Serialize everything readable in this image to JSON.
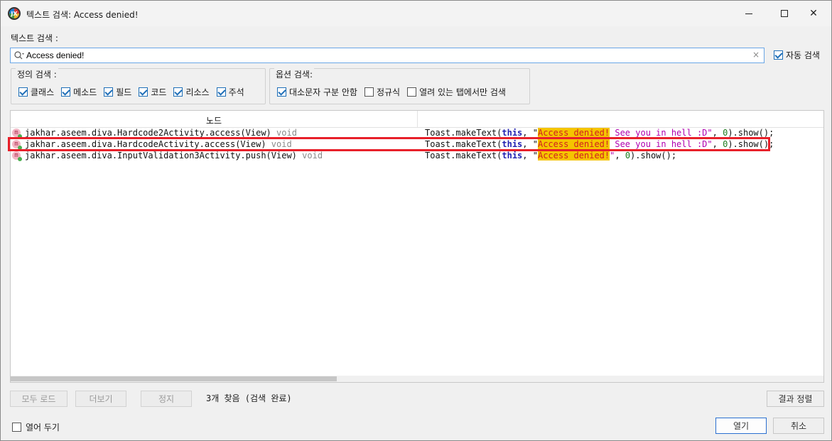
{
  "window": {
    "title": "텍스트 검색: Access denied!",
    "app_icon_text": "JX"
  },
  "search": {
    "label": "텍스트 검색 :",
    "value": "Access denied!",
    "clear_icon": "×",
    "auto_search_label": "자동 검색",
    "auto_search_checked": true
  },
  "definition_group": {
    "title": "정의 검색 :",
    "items": [
      {
        "label": "클래스",
        "checked": true
      },
      {
        "label": "메소드",
        "checked": true
      },
      {
        "label": "필드",
        "checked": true
      },
      {
        "label": "코드",
        "checked": true
      },
      {
        "label": "리소스",
        "checked": true
      },
      {
        "label": "주석",
        "checked": true
      }
    ]
  },
  "options_group": {
    "title": "옵션 검색:",
    "items": [
      {
        "label": "대소문자 구분 안함",
        "checked": true
      },
      {
        "label": "정규식",
        "checked": false
      },
      {
        "label": "열려 있는 탭에서만 검색",
        "checked": false
      }
    ]
  },
  "results": {
    "column_node": "노드",
    "rows": [
      {
        "icon": "m",
        "node": "jakhar.aseem.diva.Hardcode2Activity.access(View)",
        "return_type": "void",
        "code_prefix": "Toast.makeText(",
        "code_kw": "this",
        "code_mid": ", \"",
        "code_match": "Access denied!",
        "code_after": " See you in hell :D\"",
        "code_num_sep": ", ",
        "code_num": "0",
        "code_suffix": ").show();"
      },
      {
        "icon": "m",
        "node": "jakhar.aseem.diva.HardcodeActivity.access(View)",
        "return_type": "void",
        "code_prefix": "Toast.makeText(",
        "code_kw": "this",
        "code_mid": ", \"",
        "code_match": "Access denied!",
        "code_after": " See you in hell :D\"",
        "code_num_sep": ", ",
        "code_num": "0",
        "code_suffix": ").show();"
      },
      {
        "icon": "m",
        "node": "jakhar.aseem.diva.InputValidation3Activity.push(View)",
        "return_type": "void",
        "code_prefix": "Toast.makeText(",
        "code_kw": "this",
        "code_mid": ", \"",
        "code_match": "Access denied!",
        "code_after": "\"",
        "code_num_sep": ", ",
        "code_num": "0",
        "code_suffix": ").show();"
      }
    ]
  },
  "footer": {
    "load_all": "모두 로드",
    "more": "더보기",
    "stop": "정지",
    "status": "3개 찾음 (검색 완료)",
    "sort": "결과 정렬",
    "keep_open": "열어 두기",
    "open": "열기",
    "cancel": "취소"
  },
  "colors": {
    "highlight_border": "#e8202a",
    "match_background": "#f5c400",
    "keyword": "#1f1fb0",
    "string": "#b000b0"
  }
}
